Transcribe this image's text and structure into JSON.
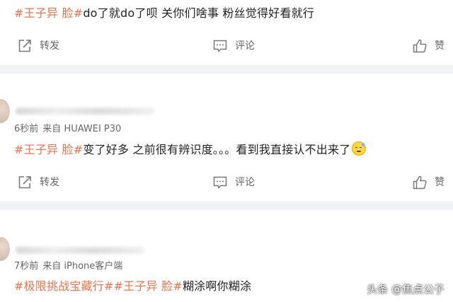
{
  "posts": [
    {
      "hashtag": "#王子异 脸#",
      "text": "do了就do了呗 关你们啥事 粉丝觉得好看就行"
    },
    {
      "time": "6秒前",
      "source": "来自 HUAWEI P30",
      "hashtag": "#王子异 脸#",
      "text": "变了好多 之前很有辨识度。。。看到我直接认不出来了",
      "emoji": "sweat-emoji"
    },
    {
      "time": "7秒前",
      "source": "来自 iPhone客户端",
      "hashtag1": "#极限挑战宝藏行#",
      "hashtag2": "#王子异 脸#",
      "text": "糊涂啊你糊涂"
    }
  ],
  "actions": {
    "repost": "转发",
    "comment": "评论",
    "like": "赞"
  },
  "icons": {
    "repost": "share-icon",
    "comment": "comment-icon",
    "like": "thumbs-up-icon"
  },
  "watermark": "头条 @焦点公子",
  "colors": {
    "hashtag": "#eb7350",
    "separator": "#f1f2f5",
    "meta_text": "#666666"
  }
}
